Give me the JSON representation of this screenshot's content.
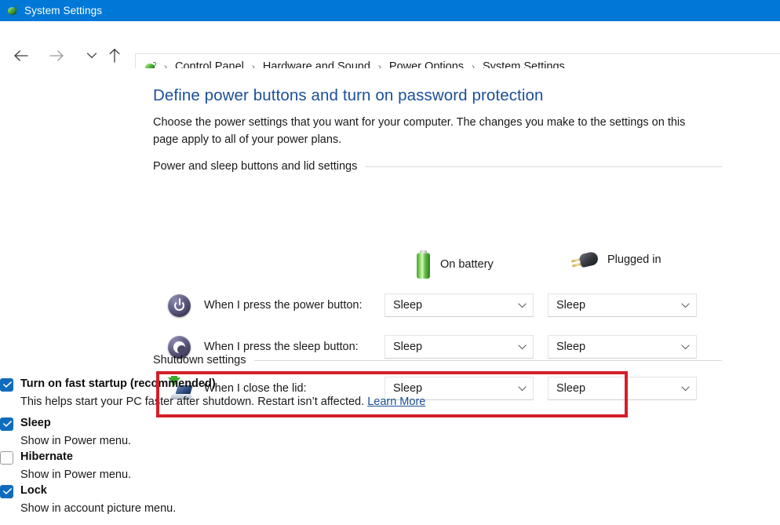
{
  "window": {
    "title": "System Settings",
    "icon": "power-plug-window-icon",
    "titlebar_color": "#0078D7"
  },
  "nav": {
    "back": "back-arrow",
    "forward": "forward-arrow",
    "recent": "recent-locations-chevron",
    "up": "up-arrow"
  },
  "breadcrumb": {
    "icon": "control-panel-power-icon",
    "separator": "›",
    "items": [
      {
        "label": "Control Panel"
      },
      {
        "label": "Hardware and Sound"
      },
      {
        "label": "Power Options"
      },
      {
        "label": "System Settings"
      }
    ]
  },
  "page": {
    "title": "Define power buttons and turn on password protection",
    "description": "Choose the power settings that you want for your computer. The changes you make to the settings on this page apply to all of your power plans."
  },
  "groups": {
    "power_and_sleep": "Power and sleep buttons and lid settings",
    "shutdown": "Shutdown settings"
  },
  "columns": [
    {
      "label": "On battery",
      "icon": "battery-icon"
    },
    {
      "label": "Plugged in",
      "icon": "power-plug-icon"
    }
  ],
  "settings_rows": [
    {
      "icon": "power-button-icon",
      "label": "When I press the power button:",
      "on_battery": "Sleep",
      "plugged_in": "Sleep"
    },
    {
      "icon": "sleep-button-icon",
      "label": "When I press the sleep button:",
      "on_battery": "Sleep",
      "plugged_in": "Sleep"
    },
    {
      "icon": "laptop-lid-icon",
      "label": "When I close the lid:",
      "on_battery": "Sleep",
      "plugged_in": "Sleep"
    }
  ],
  "shutdown_options": [
    {
      "label": "Turn on fast startup (recommended)",
      "description": "This helps start your PC faster after shutdown. Restart isn’t affected.",
      "link": "Learn More",
      "checked": true,
      "highlighted": true
    },
    {
      "label": "Sleep",
      "description": "Show in Power menu.",
      "checked": true,
      "highlighted": false
    },
    {
      "label": "Hibernate",
      "description": "Show in Power menu.",
      "checked": false,
      "highlighted": false
    },
    {
      "label": "Lock",
      "description": "Show in account picture menu.",
      "checked": true,
      "highlighted": false
    }
  ],
  "colors": {
    "accent": "#0078D7",
    "title_link": "#1b5099",
    "checkbox_on": "#0F6CBD",
    "highlight": "#D32029"
  }
}
